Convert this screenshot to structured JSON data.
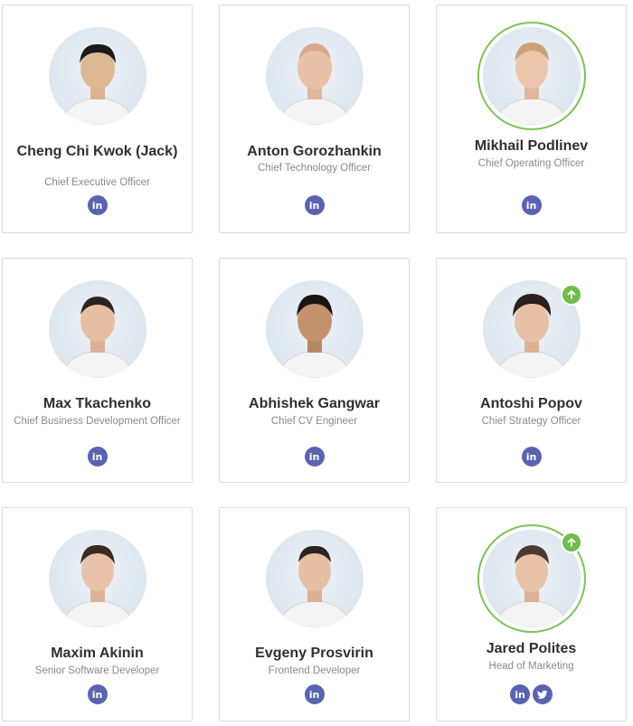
{
  "team": [
    {
      "name": "Cheng Chi Kwok (Jack)",
      "title": "Chief Executive Officer",
      "links": [
        "linkedin"
      ],
      "ring": false,
      "badge": false
    },
    {
      "name": "Anton Gorozhankin",
      "title": "Chief Technology Officer",
      "links": [
        "linkedin"
      ],
      "ring": false,
      "badge": false
    },
    {
      "name": "Mikhail Podlinev",
      "title": "Chief Operating Officer",
      "links": [
        "linkedin"
      ],
      "ring": true,
      "badge": false
    },
    {
      "name": "Max Tkachenko",
      "title": "Chief Business Development Officer",
      "links": [
        "linkedin"
      ],
      "ring": false,
      "badge": false
    },
    {
      "name": "Abhishek Gangwar",
      "title": "Chief CV Engineer",
      "links": [
        "linkedin"
      ],
      "ring": false,
      "badge": false
    },
    {
      "name": "Antoshi Popov",
      "title": "Chief Strategy Officer",
      "links": [
        "linkedin"
      ],
      "ring": false,
      "badge": true
    },
    {
      "name": "Maxim Akinin",
      "title": "Senior Software Developer",
      "links": [
        "linkedin"
      ],
      "ring": false,
      "badge": false
    },
    {
      "name": "Evgeny Prosvirin",
      "title": "Frontend Developer",
      "links": [
        "linkedin"
      ],
      "ring": false,
      "badge": false
    },
    {
      "name": "Jared Polites",
      "title": "Head of Marketing",
      "links": [
        "linkedin",
        "twitter"
      ],
      "ring": true,
      "badge": true
    }
  ],
  "icons": {
    "linkedin": "in",
    "twitter": "twitter-bird"
  },
  "colors": {
    "accent": "#5a63b0",
    "ring": "#7cc35a",
    "badge": "#6fbd4a"
  }
}
